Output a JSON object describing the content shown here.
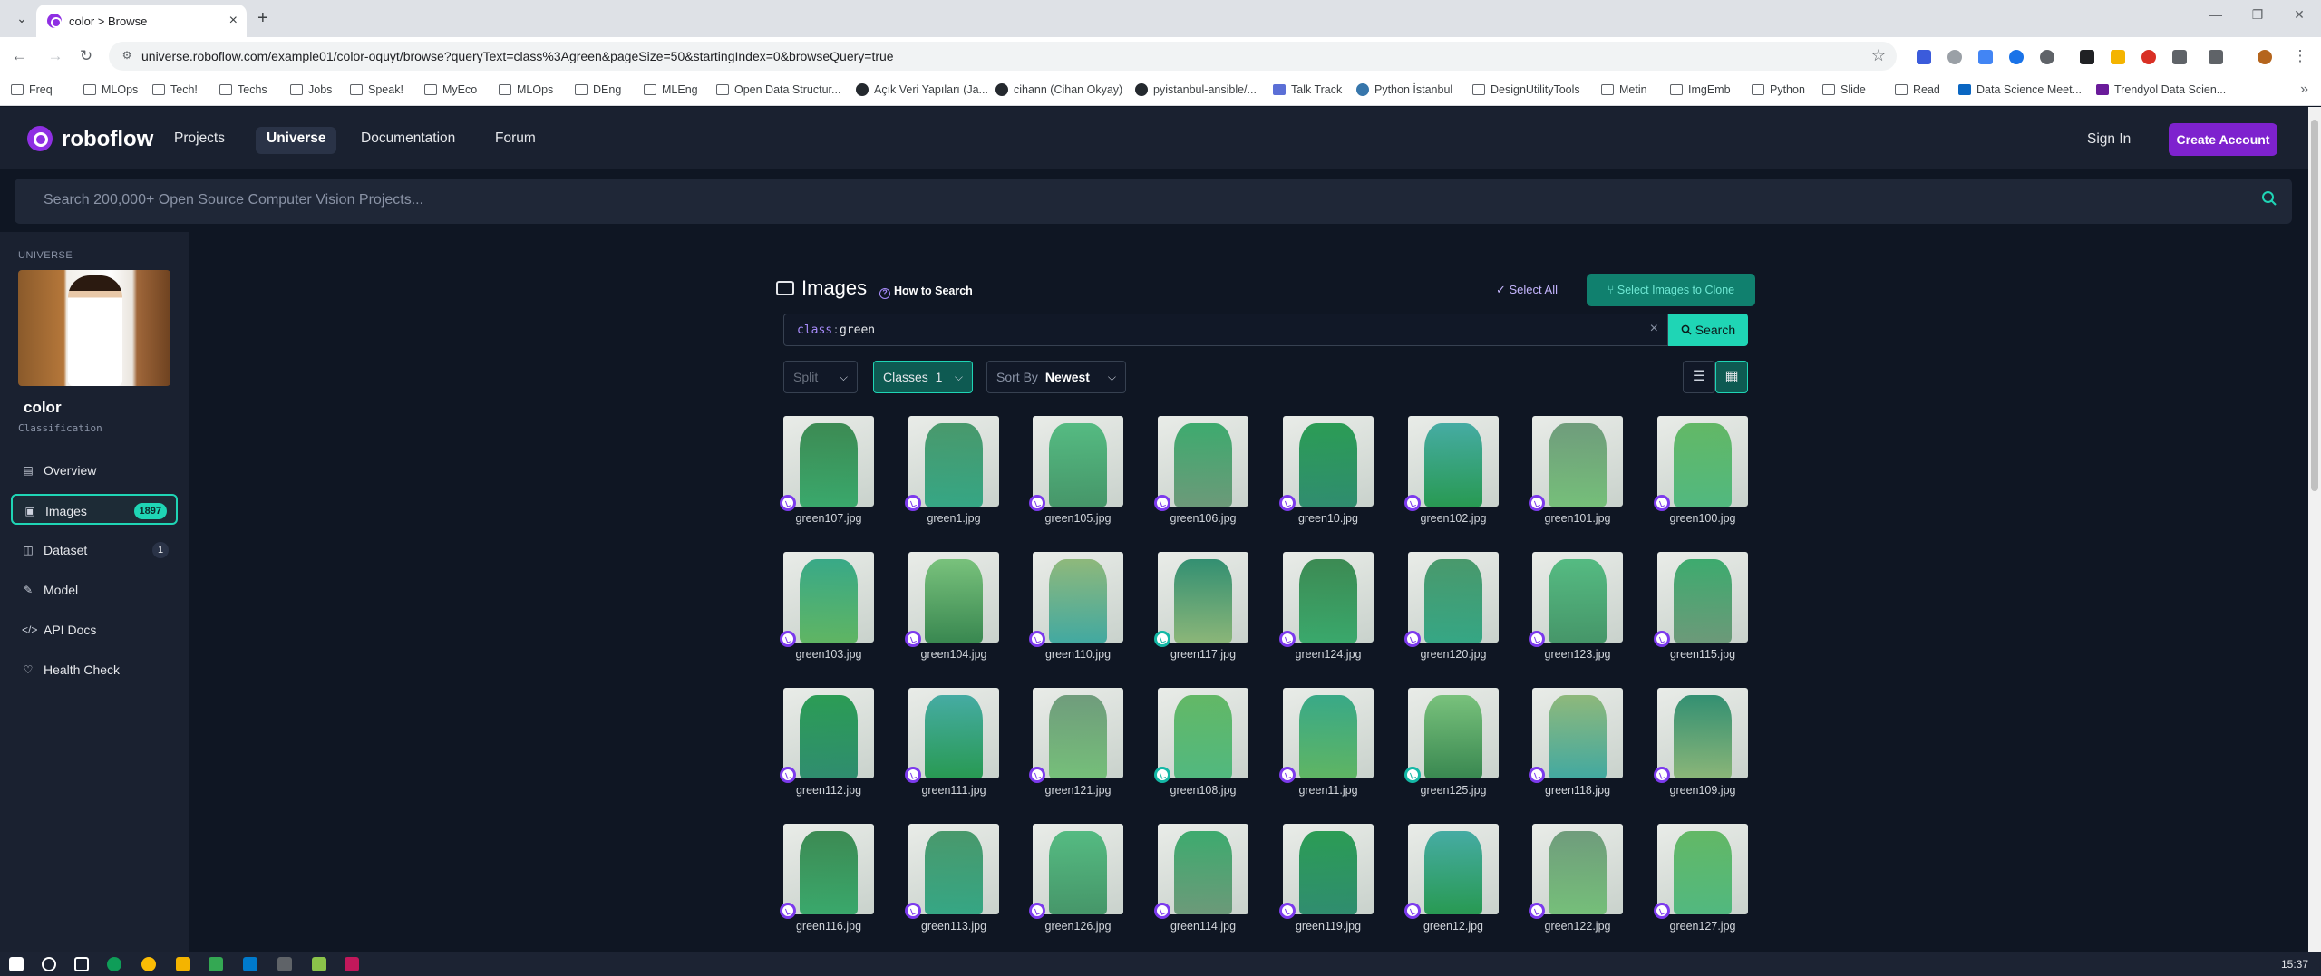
{
  "browser": {
    "tab_title": "color > Browse",
    "url": "universe.roboflow.com/example01/color-oquyt/browse?queryText=class%3Agreen&pageSize=50&startingIndex=0&browseQuery=true",
    "bookmarks": [
      "Freq",
      "MLOps",
      "Tech!",
      "Techs",
      "Jobs",
      "Speak!",
      "MyEco",
      "MLOps",
      "DEng",
      "MLEng",
      "Open Data Structur...",
      "Açık Veri Yapıları (Ja...",
      "cihann (Cihan Okyay)",
      "pyistanbul-ansible/...",
      "Talk Track",
      "Python İstanbul",
      "DesignUtilityTools",
      "Metin",
      "ImgEmb",
      "Python",
      "Slide",
      "Read",
      "Data Science Meet...",
      "Trendyol Data Scien..."
    ]
  },
  "nav": {
    "brand": "roboflow",
    "links": [
      "Projects",
      "Universe",
      "Documentation",
      "Forum"
    ],
    "signin": "Sign In",
    "create_account": "Create Account"
  },
  "universe_search": {
    "placeholder": "Search 200,000+ Open Source Computer Vision Projects..."
  },
  "sidebar": {
    "section": "UNIVERSE",
    "project_name": "color",
    "project_type": "Classification",
    "items": [
      {
        "label": "Overview",
        "icon": "overview-icon"
      },
      {
        "label": "Images",
        "icon": "images-icon",
        "badge": "1897"
      },
      {
        "label": "Dataset",
        "icon": "dataset-icon",
        "count": "1"
      },
      {
        "label": "Model",
        "icon": "model-icon"
      },
      {
        "label": "API Docs",
        "icon": "code-icon"
      },
      {
        "label": "Health Check",
        "icon": "health-icon"
      }
    ]
  },
  "images": {
    "title": "Images",
    "how_to_search": "How to Search",
    "select_all": "Select All",
    "clone_button": "Select Images to Clone",
    "query_key": "class",
    "query_sep": ":",
    "query_value": "green",
    "search_button": "Search",
    "split_label": "Split",
    "classes_label": "Classes",
    "classes_count": "1",
    "sort_prefix": "Sort By",
    "sort_value": "Newest",
    "files": [
      "green107.jpg",
      "green1.jpg",
      "green105.jpg",
      "green106.jpg",
      "green10.jpg",
      "green102.jpg",
      "green101.jpg",
      "green100.jpg",
      "green103.jpg",
      "green104.jpg",
      "green110.jpg",
      "green117.jpg",
      "green124.jpg",
      "green120.jpg",
      "green123.jpg",
      "green115.jpg",
      "green112.jpg",
      "green111.jpg",
      "green121.jpg",
      "green108.jpg",
      "green11.jpg",
      "green125.jpg",
      "green118.jpg",
      "green109.jpg",
      "green116.jpg",
      "green113.jpg",
      "green126.jpg",
      "green114.jpg",
      "green119.jpg",
      "green12.jpg",
      "green122.jpg",
      "green127.jpg"
    ]
  },
  "taskbar": {
    "clock": "15:37"
  }
}
